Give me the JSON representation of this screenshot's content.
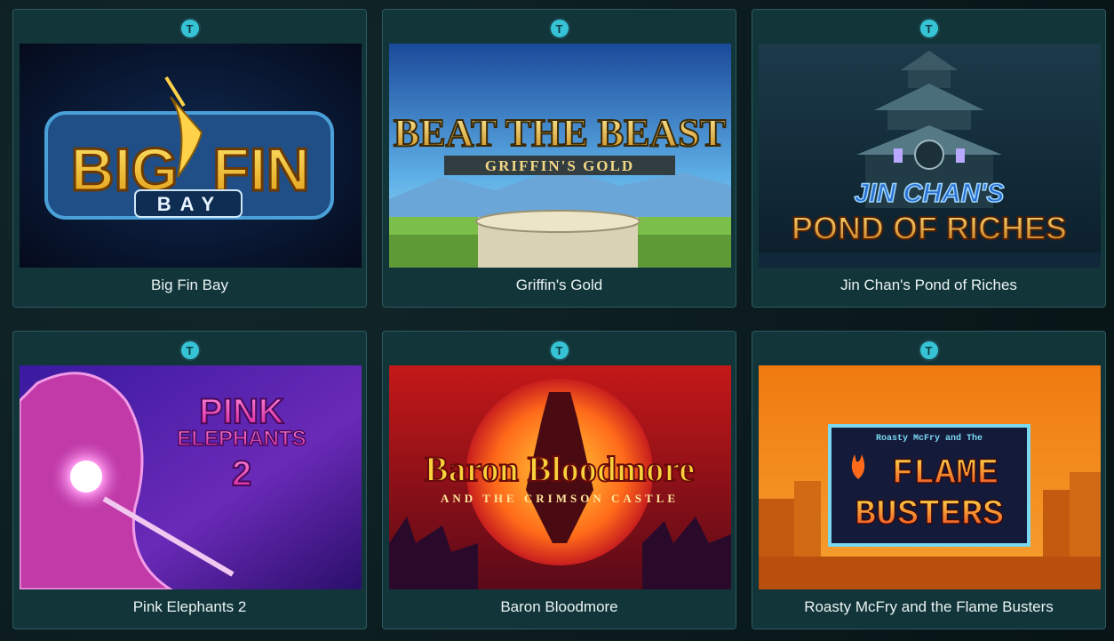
{
  "games": [
    {
      "title": "Big Fin Bay",
      "art_text": [
        "BIG",
        "FIN",
        "BAY"
      ],
      "provider_icon": "thunderkick-icon"
    },
    {
      "title": "Griffin's Gold",
      "art_text": [
        "BEAT THE BEAST",
        "GRIFFIN'S GOLD"
      ],
      "provider_icon": "thunderkick-icon"
    },
    {
      "title": "Jin Chan's Pond of Riches",
      "art_text": [
        "JIN CHAN'S",
        "POND OF RICHES"
      ],
      "provider_icon": "thunderkick-icon"
    },
    {
      "title": "Pink Elephants 2",
      "art_text": [
        "PINK",
        "ELEPHANTS",
        "2"
      ],
      "provider_icon": "thunderkick-icon"
    },
    {
      "title": "Baron Bloodmore",
      "art_text": [
        "Baron Bloodmore",
        "AND THE CRIMSON CASTLE"
      ],
      "provider_icon": "thunderkick-icon"
    },
    {
      "title": "Roasty McFry and the Flame Busters",
      "art_text": [
        "Roasty McFry and The",
        "FLAME",
        "BUSTERS"
      ],
      "provider_icon": "thunderkick-icon"
    }
  ],
  "provider_glyph": "T"
}
